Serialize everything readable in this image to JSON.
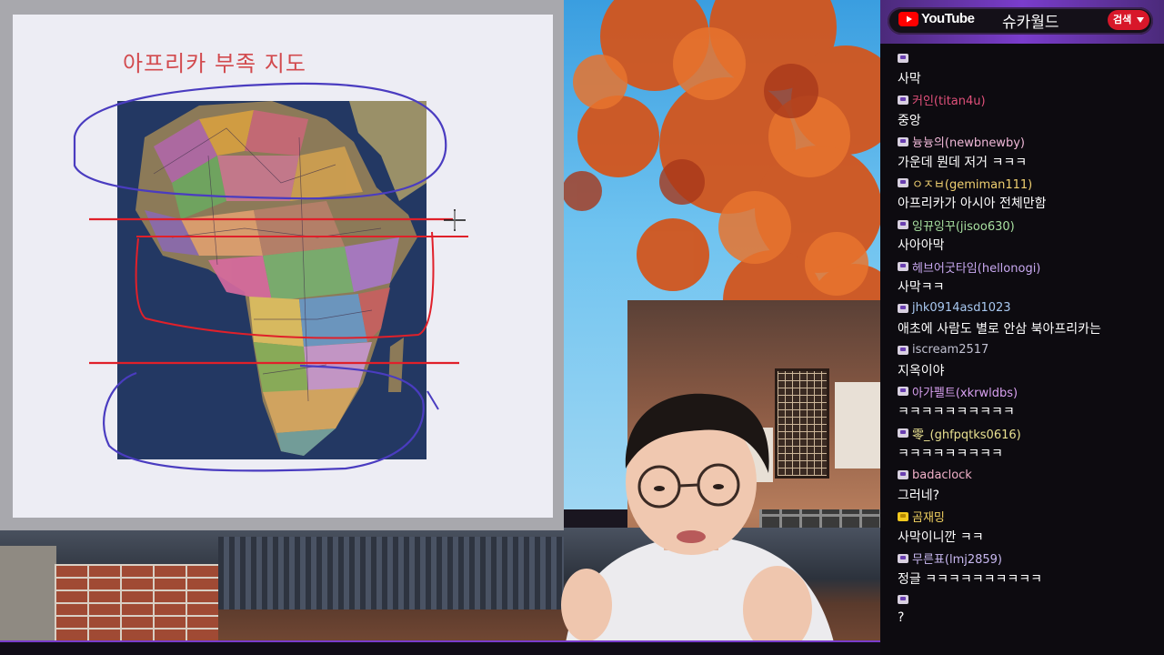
{
  "slide": {
    "title": "아프리카 부족 지도"
  },
  "chat_header": {
    "platform": "YouTube",
    "channel": "슈카월드",
    "search_label": "검색"
  },
  "chat": {
    "messages": [
      {
        "user": "",
        "text": "사막",
        "color": "#c8b8e8",
        "badge": "twitch"
      },
      {
        "user": "커인(titan4u)",
        "text": "중앙",
        "color": "#e0507a",
        "badge": "twitch"
      },
      {
        "user": "늉늉의(newbnewby)",
        "text": "가운데 뭔데 저거 ㅋㅋㅋ",
        "color": "#f0b8d8",
        "badge": "twitch"
      },
      {
        "user": "ㅇㅈㅂ(gemiman111)",
        "text": "아프리카가 아시아 전체만함",
        "color": "#f0d070",
        "badge": "twitch"
      },
      {
        "user": "잉뀨잉꾸(jisoo630)",
        "text": "사아아막",
        "color": "#a8e0a0",
        "badge": "twitch"
      },
      {
        "user": "헤브어굿타임(hellonogi)",
        "text": "사막ㅋㅋ",
        "color": "#c8a8f0",
        "badge": "twitch"
      },
      {
        "user": "jhk0914asd1023",
        "text": "애초에 사람도 별로 안삼 북아프리카는",
        "color": "#a8c8f0",
        "badge": "twitch"
      },
      {
        "user": "iscream2517",
        "text": "지옥이야",
        "color": "#c0c0d0",
        "badge": "twitch"
      },
      {
        "user": "아가펠트(xkrwldbs)",
        "text": "ㅋㅋㅋㅋㅋㅋㅋㅋㅋㅋ",
        "color": "#d8a0f0",
        "badge": "twitch"
      },
      {
        "user": "零_(ghfpqtks0616)",
        "text": "ㅋㅋㅋㅋㅋㅋㅋㅋㅋ",
        "color": "#e8e090",
        "badge": "twitch"
      },
      {
        "user": "badaclock",
        "text": "그러네?",
        "color": "#f0b0c8",
        "badge": "twitch"
      },
      {
        "user": "곰재밍",
        "text": "사막이니깐 ㅋㅋ",
        "color": "#f0d060",
        "badge": "gold"
      },
      {
        "user": "무른표(lmj2859)",
        "text": "정글 ㅋㅋㅋㅋㅋㅋㅋㅋㅋㅋ",
        "color": "#c8b8f0",
        "badge": "twitch"
      },
      {
        "user": "",
        "text": "?",
        "color": "#3050e0",
        "badge": "twitch"
      }
    ]
  },
  "colors": {
    "accent": "#7a3ccc",
    "youtube_red": "#ff0000",
    "search_red": "#d8172a",
    "annotation_red": "#e0202a",
    "annotation_blue": "#4a3cc0"
  }
}
